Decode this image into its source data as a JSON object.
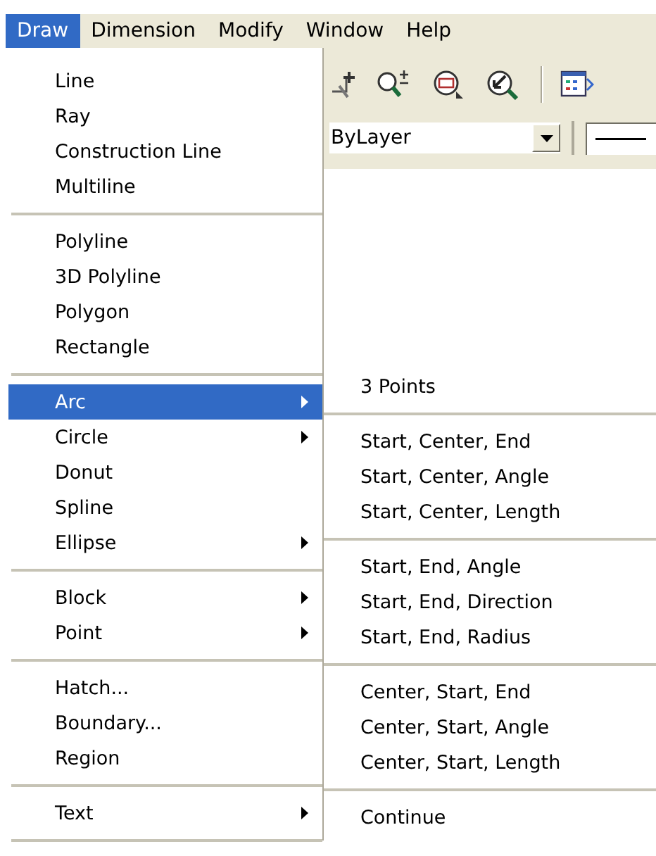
{
  "menubar": [
    {
      "label": "Draw",
      "selected": true
    },
    {
      "label": "Dimension",
      "selected": false
    },
    {
      "label": "Modify",
      "selected": false
    },
    {
      "label": "Window",
      "selected": false
    },
    {
      "label": "Help",
      "selected": false
    }
  ],
  "toolbar": {
    "layer_combo": {
      "value": "ByLayer"
    }
  },
  "draw_menu": {
    "groups": [
      [
        {
          "label": "Line",
          "has_submenu": false,
          "selected": false
        },
        {
          "label": "Ray",
          "has_submenu": false,
          "selected": false
        },
        {
          "label": "Construction Line",
          "has_submenu": false,
          "selected": false
        },
        {
          "label": "Multiline",
          "has_submenu": false,
          "selected": false
        }
      ],
      [
        {
          "label": "Polyline",
          "has_submenu": false,
          "selected": false
        },
        {
          "label": "3D Polyline",
          "has_submenu": false,
          "selected": false
        },
        {
          "label": "Polygon",
          "has_submenu": false,
          "selected": false
        },
        {
          "label": "Rectangle",
          "has_submenu": false,
          "selected": false
        }
      ],
      [
        {
          "label": "Arc",
          "has_submenu": true,
          "selected": true
        },
        {
          "label": "Circle",
          "has_submenu": true,
          "selected": false
        },
        {
          "label": "Donut",
          "has_submenu": false,
          "selected": false
        },
        {
          "label": "Spline",
          "has_submenu": false,
          "selected": false
        },
        {
          "label": "Ellipse",
          "has_submenu": true,
          "selected": false
        }
      ],
      [
        {
          "label": "Block",
          "has_submenu": true,
          "selected": false
        },
        {
          "label": "Point",
          "has_submenu": true,
          "selected": false
        }
      ],
      [
        {
          "label": "Hatch...",
          "has_submenu": false,
          "selected": false
        },
        {
          "label": "Boundary...",
          "has_submenu": false,
          "selected": false
        },
        {
          "label": "Region",
          "has_submenu": false,
          "selected": false
        }
      ],
      [
        {
          "label": "Text",
          "has_submenu": true,
          "selected": false
        }
      ]
    ]
  },
  "arc_submenu": {
    "groups": [
      [
        "3 Points"
      ],
      [
        "Start, Center, End",
        "Start, Center, Angle",
        "Start, Center, Length"
      ],
      [
        "Start, End, Angle",
        "Start, End, Direction",
        "Start, End, Radius"
      ],
      [
        "Center, Start, End",
        "Center, Start, Angle",
        "Center, Start, Length"
      ],
      [
        "Continue"
      ]
    ]
  }
}
